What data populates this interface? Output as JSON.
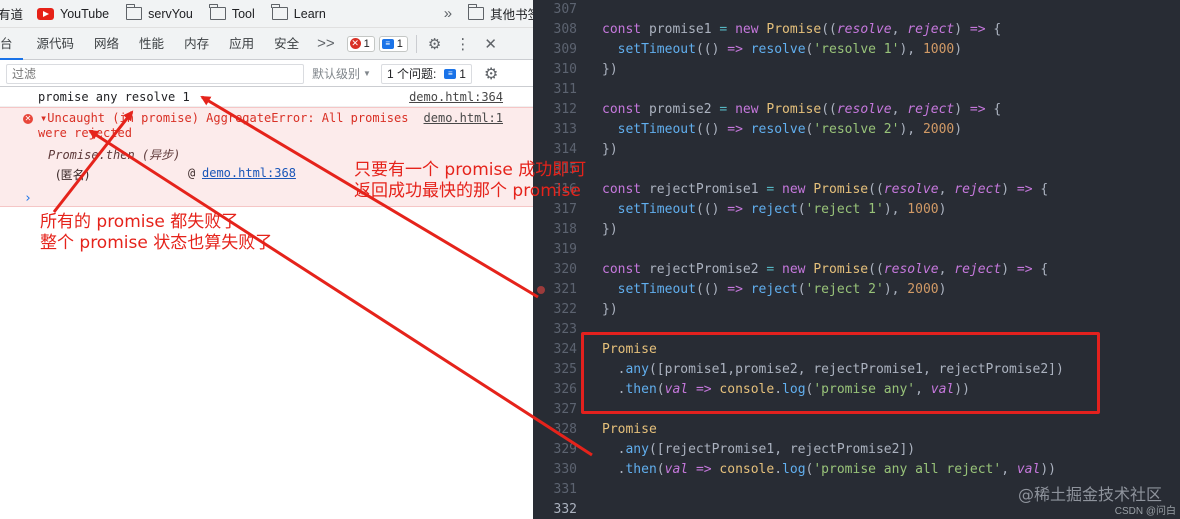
{
  "bookmarks": {
    "items": [
      {
        "label": "有道",
        "icon": "none"
      },
      {
        "label": "YouTube",
        "icon": "youtube-icon"
      },
      {
        "label": "servYou",
        "icon": "folder-icon"
      },
      {
        "label": "Tool",
        "icon": "folder-icon"
      },
      {
        "label": "Learn",
        "icon": "folder-icon"
      }
    ],
    "more": "»",
    "other": "其他书签"
  },
  "devtools": {
    "tabs": [
      "台",
      "源代码",
      "网络",
      "性能",
      "内存",
      "应用",
      "安全"
    ],
    "more_tabs": ">>",
    "error_count": "1",
    "message_count": "1"
  },
  "filter": {
    "placeholder": "过滤",
    "levels": "默认级别",
    "issues_label": "1 个问题:",
    "issues_count": "1"
  },
  "console": {
    "log": {
      "text": "promise any resolve 1",
      "link": "demo.html:364"
    },
    "error": {
      "line1": "Uncaught (in promise) AggregateError: All promises",
      "line2": "were rejected",
      "link": "demo.html:1",
      "stack_frame": "Promise.then (异步)",
      "anon": "(匿名)",
      "at": "@",
      "anon_link": "demo.html:368"
    },
    "prompt": "›"
  },
  "editor": {
    "line_numbers": [
      "307",
      "308",
      "309",
      "310",
      "311",
      "312",
      "313",
      "314",
      "315",
      "316",
      "317",
      "318",
      "319",
      "320",
      "321",
      "322",
      "323",
      "324",
      "325",
      "326",
      "327",
      "328",
      "329",
      "330",
      "331",
      "332"
    ],
    "code": {
      "l308": "const promise1 = new Promise((resolve, reject) => {",
      "l309": "  setTimeout(() => resolve('resolve 1'), 1000)",
      "l310": "})",
      "l312": "const promise2 = new Promise((resolve, reject) => {",
      "l313": "  setTimeout(() => resolve('resolve 2'), 2000)",
      "l314": "})",
      "l316": "const rejectPromise1 = new Promise((resolve, reject) => {",
      "l317": "  setTimeout(() => reject('reject 1'), 1000)",
      "l318": "})",
      "l320": "const rejectPromise2 = new Promise((resolve, reject) => {",
      "l321": "  setTimeout(() => reject('reject 2'), 2000)",
      "l322": "})",
      "l324": "Promise",
      "l325": "  .any([promise1,promise2, rejectPromise1, rejectPromise2])",
      "l326": "  .then(val => console.log('promise any', val))",
      "l328": "Promise",
      "l329": "  .any([rejectPromise1, rejectPromise2])",
      "l330": "  .then(val => console.log('promise any all reject', val))"
    },
    "watermark": "@稀土掘金技术社区",
    "csdn": "CSDN @问白"
  },
  "annotations": {
    "success_line1": "只要有一个 promise 成功即可",
    "success_line2": "返回成功最快的那个 promise",
    "fail_line1": "所有的 promise 都失败了",
    "fail_line2": "整个 promise 状态也算失败了"
  },
  "colors": {
    "annotation": "#e5231b",
    "editor_bg": "#282c34",
    "error_bg": "#fcebeb",
    "error_text": "#d93025",
    "highlight_box": "#e3211e"
  }
}
